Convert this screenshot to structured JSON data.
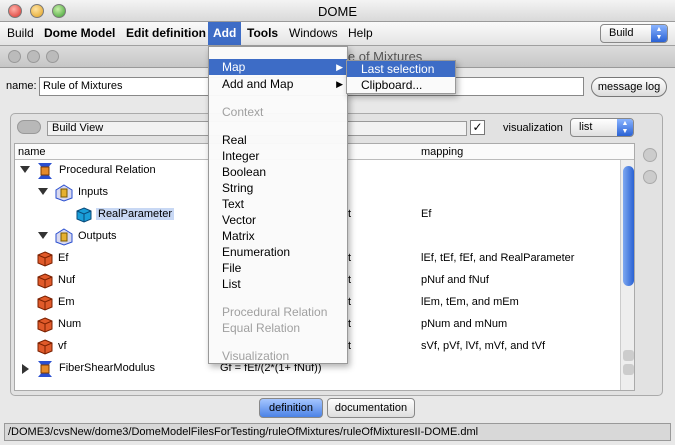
{
  "window": {
    "title": "DOME",
    "inner_title_fragment": "le of Mixtures"
  },
  "menubar": {
    "items": [
      "Build",
      "Dome Model",
      "Edit definition",
      "Add",
      "Tools",
      "Windows",
      "Help"
    ],
    "mode_select": "Build"
  },
  "model": {
    "name_label": "name:",
    "name_value": "Rule of Mixtures",
    "message_log": "message log"
  },
  "view": {
    "view_name": "Build View",
    "visualization_label": "visualization",
    "visualization_value": "list"
  },
  "table": {
    "headers": {
      "name": "name",
      "mapping": "mapping"
    },
    "rows": [
      {
        "name": "Procedural Relation",
        "mid": "",
        "mapping": ""
      },
      {
        "name": "Inputs",
        "mid": "",
        "mapping": ""
      },
      {
        "name": "RealParameter",
        "mid": "t",
        "mapping": "Ef"
      },
      {
        "name": "Outputs",
        "mid": "",
        "mapping": ""
      },
      {
        "name": "Ef",
        "mid": "t",
        "mapping": "lEf, tEf, fEf, and RealParameter"
      },
      {
        "name": "Nuf",
        "mid": "t",
        "mapping": "pNuf and fNuf"
      },
      {
        "name": "Em",
        "mid": "t",
        "mapping": "lEm, tEm, and mEm"
      },
      {
        "name": "Num",
        "mid": "t",
        "mapping": "pNum and mNum"
      },
      {
        "name": "vf",
        "mid": "t",
        "mapping": "sVf, pVf, lVf, mVf, and tVf"
      },
      {
        "name": "FiberShearModulus",
        "mid": "Gf = fEf/(2*(1+ fNuf))",
        "mapping": ""
      }
    ]
  },
  "tabs": {
    "definition": "definition",
    "documentation": "documentation"
  },
  "status_path": "/DOME3/cvsNew/dome3/DomeModelFilesForTesting/ruleOfMixtures/ruleOfMixturesII-DOME.dml",
  "add_menu": {
    "items": [
      {
        "label": "Map",
        "state": "highlighted",
        "submenu": true
      },
      {
        "label": "Add and Map",
        "state": "enabled",
        "submenu": true
      },
      {
        "label": "Context",
        "state": "disabled"
      },
      {
        "label": "Real",
        "state": "enabled"
      },
      {
        "label": "Integer",
        "state": "enabled"
      },
      {
        "label": "Boolean",
        "state": "enabled"
      },
      {
        "label": "String",
        "state": "enabled"
      },
      {
        "label": "Text",
        "state": "enabled"
      },
      {
        "label": "Vector",
        "state": "enabled"
      },
      {
        "label": "Matrix",
        "state": "enabled"
      },
      {
        "label": "Enumeration",
        "state": "enabled"
      },
      {
        "label": "File",
        "state": "enabled"
      },
      {
        "label": "List",
        "state": "enabled"
      },
      {
        "label": "Procedural Relation",
        "state": "disabled"
      },
      {
        "label": "Equal Relation",
        "state": "disabled"
      },
      {
        "label": "Visualization",
        "state": "disabled"
      }
    ],
    "submenu": [
      "Last selection",
      "Clipboard..."
    ]
  }
}
